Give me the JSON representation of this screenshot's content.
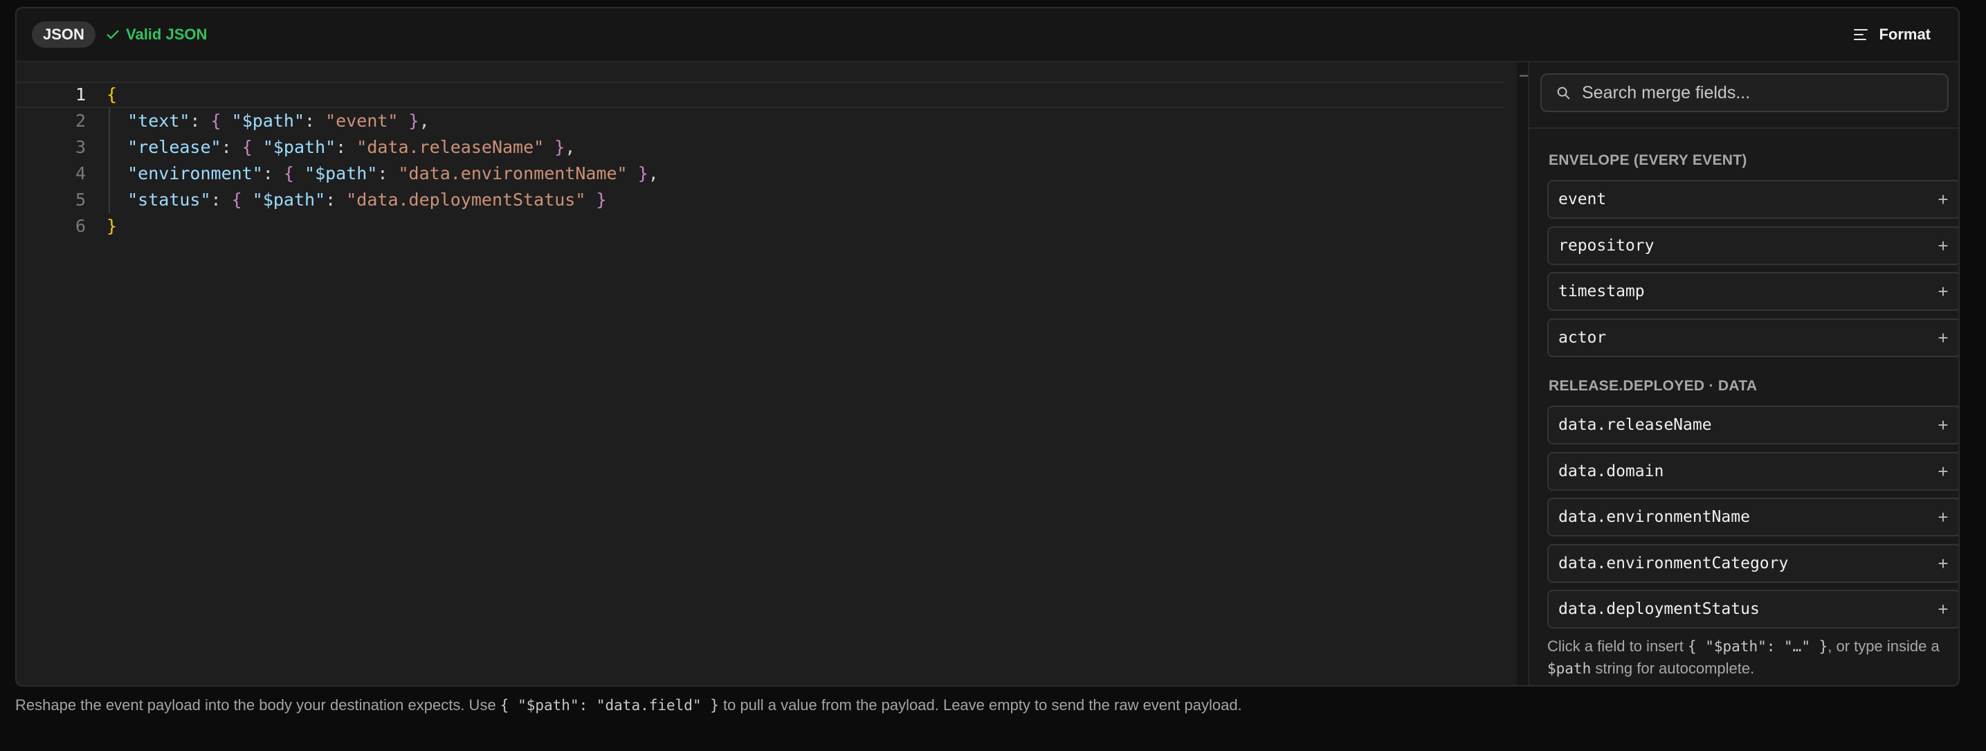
{
  "header": {
    "mode_badge": "JSON",
    "validity": "Valid JSON",
    "format_label": "Format",
    "validity_color": "#34c25c"
  },
  "editor": {
    "active_line": 1,
    "lines": [
      {
        "number": "1",
        "tokens": [
          {
            "t": "brace",
            "v": "{"
          }
        ]
      },
      {
        "number": "2",
        "tokens": [
          {
            "t": "punc",
            "v": "  "
          },
          {
            "t": "key",
            "v": "\"text\""
          },
          {
            "t": "punc",
            "v": ": "
          },
          {
            "t": "ibrace",
            "v": "{"
          },
          {
            "t": "punc",
            "v": " "
          },
          {
            "t": "key",
            "v": "\"$path\""
          },
          {
            "t": "punc",
            "v": ": "
          },
          {
            "t": "str",
            "v": "\"event\""
          },
          {
            "t": "punc",
            "v": " "
          },
          {
            "t": "ibrace",
            "v": "}"
          },
          {
            "t": "punc",
            "v": ","
          }
        ]
      },
      {
        "number": "3",
        "tokens": [
          {
            "t": "punc",
            "v": "  "
          },
          {
            "t": "key",
            "v": "\"release\""
          },
          {
            "t": "punc",
            "v": ": "
          },
          {
            "t": "ibrace",
            "v": "{"
          },
          {
            "t": "punc",
            "v": " "
          },
          {
            "t": "key",
            "v": "\"$path\""
          },
          {
            "t": "punc",
            "v": ": "
          },
          {
            "t": "str",
            "v": "\"data.releaseName\""
          },
          {
            "t": "punc",
            "v": " "
          },
          {
            "t": "ibrace",
            "v": "}"
          },
          {
            "t": "punc",
            "v": ","
          }
        ]
      },
      {
        "number": "4",
        "tokens": [
          {
            "t": "punc",
            "v": "  "
          },
          {
            "t": "key",
            "v": "\"environment\""
          },
          {
            "t": "punc",
            "v": ": "
          },
          {
            "t": "ibrace",
            "v": "{"
          },
          {
            "t": "punc",
            "v": " "
          },
          {
            "t": "key",
            "v": "\"$path\""
          },
          {
            "t": "punc",
            "v": ": "
          },
          {
            "t": "str",
            "v": "\"data.environmentName\""
          },
          {
            "t": "punc",
            "v": " "
          },
          {
            "t": "ibrace",
            "v": "}"
          },
          {
            "t": "punc",
            "v": ","
          }
        ]
      },
      {
        "number": "5",
        "tokens": [
          {
            "t": "punc",
            "v": "  "
          },
          {
            "t": "key",
            "v": "\"status\""
          },
          {
            "t": "punc",
            "v": ": "
          },
          {
            "t": "ibrace",
            "v": "{"
          },
          {
            "t": "punc",
            "v": " "
          },
          {
            "t": "key",
            "v": "\"$path\""
          },
          {
            "t": "punc",
            "v": ": "
          },
          {
            "t": "str",
            "v": "\"data.deploymentStatus\""
          },
          {
            "t": "punc",
            "v": " "
          },
          {
            "t": "ibrace",
            "v": "}"
          }
        ]
      },
      {
        "number": "6",
        "tokens": [
          {
            "t": "brace",
            "v": "}"
          }
        ]
      }
    ]
  },
  "sidebar": {
    "search_placeholder": "Search merge fields...",
    "sections": [
      {
        "title": "ENVELOPE (EVERY EVENT)",
        "fields": [
          "event",
          "repository",
          "timestamp",
          "actor"
        ]
      },
      {
        "title": "RELEASE.DEPLOYED · DATA",
        "fields": [
          "data.releaseName",
          "data.domain",
          "data.environmentName",
          "data.environmentCategory",
          "data.deploymentStatus"
        ]
      }
    ],
    "hint_prefix": "Click a field to insert ",
    "hint_code": "{ \"$path\": \"…\" }",
    "hint_middle": ", or type inside a ",
    "hint_code2": "$path",
    "hint_suffix": " string for autocomplete."
  },
  "footer": {
    "prefix": "Reshape the event payload into the body your destination expects. Use ",
    "code": "{ \"$path\": \"data.field\" }",
    "suffix": " to pull a value from the payload. Leave empty to send the raw event payload."
  }
}
